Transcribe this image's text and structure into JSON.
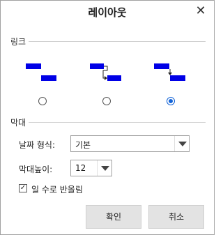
{
  "dialog": {
    "title": "레이아웃",
    "close_glyph": "✕"
  },
  "link_section": {
    "label": "링크",
    "options": [
      {
        "icon": "link-straight-icon",
        "selected": false
      },
      {
        "icon": "link-elbow-icon",
        "selected": false
      },
      {
        "icon": "link-down-icon",
        "selected": true
      }
    ]
  },
  "bar_section": {
    "label": "막대",
    "date_format_label": "날짜 형식:",
    "date_format_value": "기본",
    "bar_height_label": "막대높이:",
    "bar_height_value": "12",
    "round_days_checked": true,
    "round_days_label": "일 수로 반올림",
    "check_glyph": "✓"
  },
  "buttons": {
    "ok_label": "확인",
    "cancel_label": "취소"
  },
  "colors": {
    "bar_blue": "#0000e6",
    "radio_selected": "#1565d8"
  }
}
